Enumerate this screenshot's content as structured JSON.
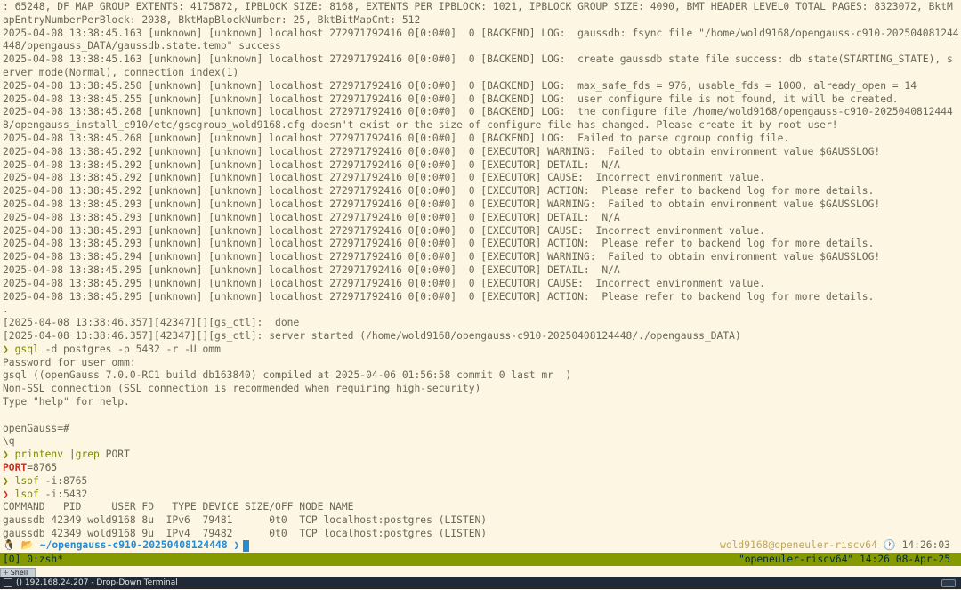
{
  "log_lines": [
    ": 65248, DF_MAP_GROUP_EXTENTS: 4175872, IPBLOCK_SIZE: 8168, EXTENTS_PER_IPBLOCK: 1021, IPBLOCK_GROUP_SIZE: 4090, BMT_HEADER_LEVEL0_TOTAL_PAGES: 8323072, BktM",
    "apEntryNumberPerBlock: 2038, BktMapBlockNumber: 25, BktBitMapCnt: 512",
    "2025-04-08 13:38:45.163 [unknown] [unknown] localhost 272971792416 0[0:0#0]  0 [BACKEND] LOG:  gaussdb: fsync file \"/home/wold9168/opengauss-c910-202504081244",
    "448/opengauss_DATA/gaussdb.state.temp\" success",
    "2025-04-08 13:38:45.163 [unknown] [unknown] localhost 272971792416 0[0:0#0]  0 [BACKEND] LOG:  create gaussdb state file success: db state(STARTING_STATE), s",
    "erver mode(Normal), connection index(1)",
    "2025-04-08 13:38:45.250 [unknown] [unknown] localhost 272971792416 0[0:0#0]  0 [BACKEND] LOG:  max_safe_fds = 976, usable_fds = 1000, already_open = 14",
    "2025-04-08 13:38:45.255 [unknown] [unknown] localhost 272971792416 0[0:0#0]  0 [BACKEND] LOG:  user configure file is not found, it will be created.",
    "2025-04-08 13:38:45.268 [unknown] [unknown] localhost 272971792416 0[0:0#0]  0 [BACKEND] LOG:  the configure file /home/wold9168/opengauss-c910-2025040812444",
    "8/opengauss_install_c910/etc/gscgroup_wold9168.cfg doesn't exist or the size of configure file has changed. Please create it by root user!",
    "2025-04-08 13:38:45.268 [unknown] [unknown] localhost 272971792416 0[0:0#0]  0 [BACKEND] LOG:  Failed to parse cgroup config file.",
    "2025-04-08 13:38:45.292 [unknown] [unknown] localhost 272971792416 0[0:0#0]  0 [EXECUTOR] WARNING:  Failed to obtain environment value $GAUSSLOG!",
    "2025-04-08 13:38:45.292 [unknown] [unknown] localhost 272971792416 0[0:0#0]  0 [EXECUTOR] DETAIL:  N/A",
    "2025-04-08 13:38:45.292 [unknown] [unknown] localhost 272971792416 0[0:0#0]  0 [EXECUTOR] CAUSE:  Incorrect environment value.",
    "2025-04-08 13:38:45.292 [unknown] [unknown] localhost 272971792416 0[0:0#0]  0 [EXECUTOR] ACTION:  Please refer to backend log for more details.",
    "2025-04-08 13:38:45.293 [unknown] [unknown] localhost 272971792416 0[0:0#0]  0 [EXECUTOR] WARNING:  Failed to obtain environment value $GAUSSLOG!",
    "2025-04-08 13:38:45.293 [unknown] [unknown] localhost 272971792416 0[0:0#0]  0 [EXECUTOR] DETAIL:  N/A",
    "2025-04-08 13:38:45.293 [unknown] [unknown] localhost 272971792416 0[0:0#0]  0 [EXECUTOR] CAUSE:  Incorrect environment value.",
    "2025-04-08 13:38:45.293 [unknown] [unknown] localhost 272971792416 0[0:0#0]  0 [EXECUTOR] ACTION:  Please refer to backend log for more details.",
    "2025-04-08 13:38:45.294 [unknown] [unknown] localhost 272971792416 0[0:0#0]  0 [EXECUTOR] WARNING:  Failed to obtain environment value $GAUSSLOG!",
    "2025-04-08 13:38:45.295 [unknown] [unknown] localhost 272971792416 0[0:0#0]  0 [EXECUTOR] DETAIL:  N/A",
    "2025-04-08 13:38:45.295 [unknown] [unknown] localhost 272971792416 0[0:0#0]  0 [EXECUTOR] CAUSE:  Incorrect environment value.",
    "2025-04-08 13:38:45.295 [unknown] [unknown] localhost 272971792416 0[0:0#0]  0 [EXECUTOR] ACTION:  Please refer to backend log for more details.",
    ".",
    "[2025-04-08 13:38:46.357][42347][][gs_ctl]:  done",
    "[2025-04-08 13:38:46.357][42347][][gs_ctl]: server started (/home/wold9168/opengauss-c910-20250408124448/./opengauss_DATA)"
  ],
  "session_lines": [
    {
      "prompt": "❯",
      "cmd": "gsql",
      "rest": " -d postgres -p 5432 -r -U omm",
      "prompt_color": "green"
    },
    {
      "text": "Password for user omm:"
    },
    {
      "text": "gsql ((openGauss 7.0.0-RC1 build db163840) compiled at 2025-04-06 01:56:58 commit 0 last mr  )"
    },
    {
      "text": "Non-SSL connection (SSL connection is recommended when requiring high-security)"
    },
    {
      "text": "Type \"help\" for help."
    },
    {
      "text": ""
    },
    {
      "text": "openGauss=#"
    },
    {
      "text": "\\q"
    },
    {
      "prompt": "❯",
      "cmd": "printenv",
      "rest": " |",
      "cmd2": "grep",
      "rest2": " PORT",
      "prompt_color": "green"
    },
    {
      "env_key": "PORT",
      "env_val": "=8765"
    },
    {
      "prompt": "❯",
      "cmd": "lsof",
      "rest": " -i:8765",
      "prompt_color": "green"
    },
    {
      "prompt": "❯",
      "cmd": "lsof",
      "rest": " -i:5432",
      "prompt_color": "red"
    },
    {
      "text": "COMMAND   PID     USER FD   TYPE DEVICE SIZE/OFF NODE NAME"
    },
    {
      "text": "gaussdb 42349 wold9168 8u  IPv6  79481      0t0  TCP localhost:postgres (LISTEN)"
    },
    {
      "text": "gaussdb 42349 wold9168 9u  IPv4  79482      0t0  TCP localhost:postgres (LISTEN)"
    }
  ],
  "prompt": {
    "os_glyph": "🐧",
    "folder_glyph": "📂",
    "path": "~/opengauss-c910-20250408124448",
    "arrow": "❯",
    "user_host": "wold9168@openeuler-riscv64",
    "clock_glyph": "🕐",
    "time": "14:26:03"
  },
  "tmux": {
    "left": "[0] 0:zsh*",
    "right": "\"openeuler-riscv64\" 14:26 08-Apr-25"
  },
  "dropdown_tab": {
    "plus": "+",
    "label": "Shell"
  },
  "taskbar": {
    "title": "() 192.168.24.207 - Drop-Down Terminal"
  },
  "colors": {
    "background": "#fdf6e3",
    "text": "#6a6657",
    "green": "#7b8a00",
    "red": "#cb2e24",
    "blue": "#268bd2",
    "tmux_bar": "#859900"
  }
}
